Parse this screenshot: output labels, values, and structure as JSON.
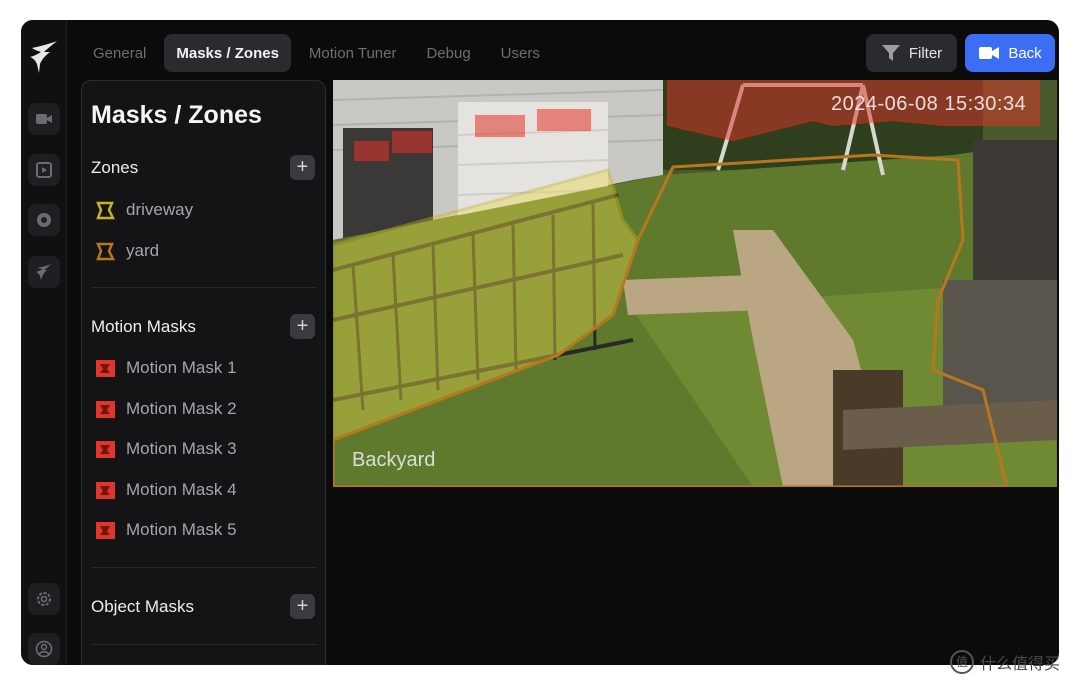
{
  "nav": {
    "tabs": [
      {
        "label": "General"
      },
      {
        "label": "Masks / Zones",
        "active": true
      },
      {
        "label": "Motion Tuner"
      },
      {
        "label": "Debug"
      },
      {
        "label": "Users"
      }
    ],
    "filter_label": "Filter",
    "back_label": "Back"
  },
  "panel": {
    "title": "Masks / Zones",
    "zones": {
      "title": "Zones",
      "items": [
        {
          "label": "driveway",
          "color": "#c9b21d"
        },
        {
          "label": "yard",
          "color": "#b8771f"
        }
      ]
    },
    "motion_masks": {
      "title": "Motion Masks",
      "items": [
        {
          "label": "Motion Mask 1"
        },
        {
          "label": "Motion Mask 2"
        },
        {
          "label": "Motion Mask 3"
        },
        {
          "label": "Motion Mask 4"
        },
        {
          "label": "Motion Mask 5"
        }
      ],
      "color": "#e0352b"
    },
    "object_masks": {
      "title": "Object Masks"
    }
  },
  "camera": {
    "name": "Backyard",
    "timestamp": "2024-06-08 15:30:34"
  },
  "watermark": {
    "text": "什么值得买",
    "badge": "值"
  },
  "colors": {
    "accent": "#3b6ef5",
    "zone_driveway": "#c9b21d",
    "zone_yard": "#b8771f",
    "motion_mask": "#e0352b"
  }
}
